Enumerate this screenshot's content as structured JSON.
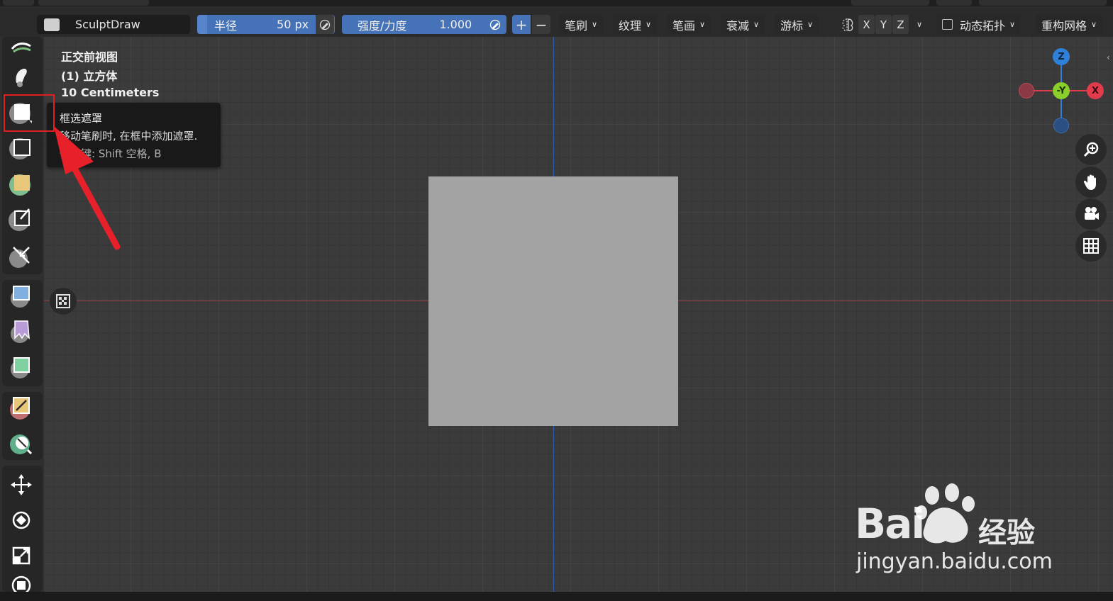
{
  "header": {
    "brush_name": "SculptDraw",
    "radius_label": "半径",
    "radius_value": "50 px",
    "strength_label": "强度/力度",
    "strength_value": "1.000",
    "plus_label": "+",
    "minus_label": "−",
    "menus": [
      "笔刷",
      "纹理",
      "笔画",
      "衰减",
      "游标"
    ],
    "axes": [
      "X",
      "Y",
      "Z"
    ],
    "dyntopo_label": "动态拓扑",
    "remesh_label": "重构网格"
  },
  "viewport": {
    "view_name": "正交前视图",
    "object_name": "(1) 立方体",
    "scale": "10 Centimeters",
    "gizmo": {
      "z_label": "Z",
      "y_label": "-Y",
      "x_label": "X"
    }
  },
  "tooltip": {
    "title": "框选遮罩",
    "description": "移动笔刷时, 在框中添加遮罩.",
    "shortcut": "快捷键: Shift 空格, B"
  },
  "watermark": {
    "brand": "Bai",
    "brand_suffix": "经验",
    "url": "jingyan.baidu.com"
  },
  "colors": {
    "accent_blue": "#4673b8",
    "highlight_red": "#e02020",
    "gizmo_x": "#e23b4c",
    "gizmo_y": "#8bd02a",
    "gizmo_z": "#2f80d9"
  }
}
